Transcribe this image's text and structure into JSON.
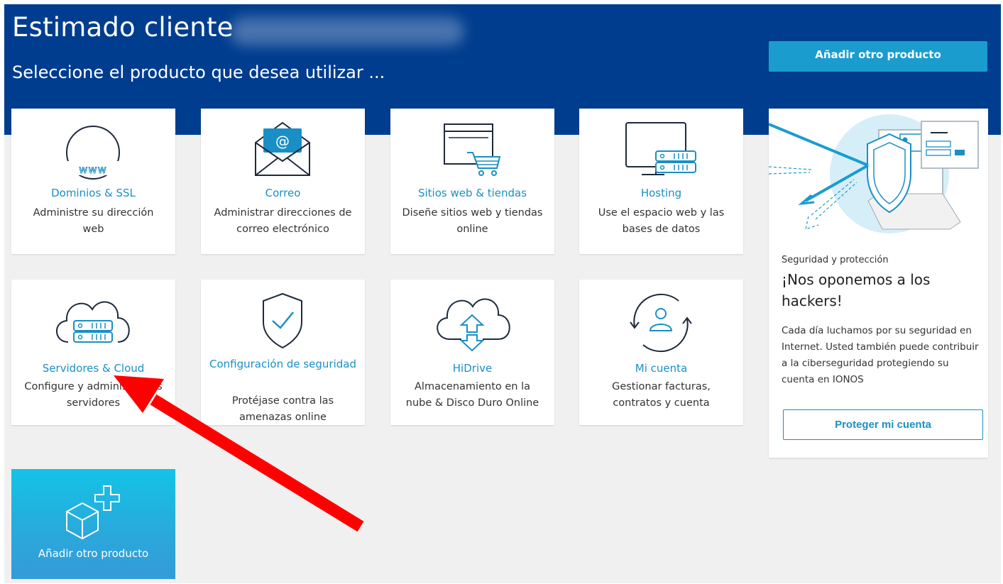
{
  "header": {
    "greeting": "Estimado cliente",
    "subtitle": "Seleccione el producto que desea utilizar ...",
    "add_product_button": "Añadir otro producto"
  },
  "products": [
    {
      "title": "Dominios & SSL",
      "description": "Administre su dirección web",
      "icon": "www-globe-icon"
    },
    {
      "title": "Correo",
      "description": "Administrar direcciones de correo electrónico",
      "icon": "envelope-icon"
    },
    {
      "title": "Sitios web & tiendas",
      "description": "Diseñe sitios web y tiendas online",
      "icon": "website-cart-icon"
    },
    {
      "title": "Hosting",
      "description": "Use el espacio web y las bases de datos",
      "icon": "monitor-server-icon"
    },
    {
      "title": "Servidores & Cloud",
      "description": "Configure y administre sus servidores",
      "icon": "cloud-server-icon"
    },
    {
      "title": "Configuración de seguridad",
      "description": "Protéjase contra las amenazas online",
      "icon": "shield-check-icon"
    },
    {
      "title": "HiDrive",
      "description": "Almacenamiento en la nube & Disco Duro Online",
      "icon": "cloud-upload-icon"
    },
    {
      "title": "Mi cuenta",
      "description": "Gestionar facturas, contratos y cuenta",
      "icon": "user-cycle-icon"
    }
  ],
  "add_tile": {
    "label": "Añadir otro producto",
    "icon": "box-plus-icon"
  },
  "promo": {
    "kicker": "Seguridad y protección",
    "headline": "¡Nos oponemos a los hackers!",
    "body": "Cada día luchamos por su seguridad en Internet. Usted también puede contribuir a la ciberseguridad protegiendo su cuenta en IONOS",
    "button": "Proteger mi cuenta"
  },
  "colors": {
    "header_bg": "#003d8f",
    "accent": "#1a8fc5",
    "button_bg": "#1a9ccf",
    "icon_dark": "#1f2a3c",
    "annotation_arrow": "#ff0000"
  }
}
